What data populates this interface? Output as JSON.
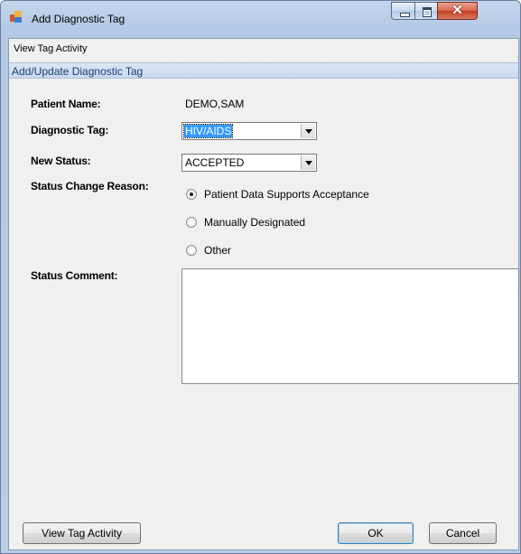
{
  "window": {
    "title": "Add Diagnostic Tag",
    "icon": "app-window-icon"
  },
  "menu": {
    "view_tag_activity": "View Tag Activity"
  },
  "group_header": "Add/Update Diagnostic Tag",
  "form": {
    "patient_name_label": "Patient Name:",
    "patient_name_value": "DEMO,SAM",
    "diagnostic_tag_label": "Diagnostic Tag:",
    "diagnostic_tag_value": "HIV/AIDS",
    "new_status_label": "New Status:",
    "new_status_value": "ACCEPTED",
    "status_change_reason_label": "Status Change Reason:",
    "reasons": [
      {
        "label": "Patient Data Supports Acceptance",
        "selected": true
      },
      {
        "label": "Manually Designated",
        "selected": false
      },
      {
        "label": "Other",
        "selected": false
      }
    ],
    "status_comment_label": "Status Comment:",
    "status_comment_value": ""
  },
  "buttons": {
    "view_tag_activity": "View Tag Activity",
    "ok": "OK",
    "cancel": "Cancel"
  }
}
